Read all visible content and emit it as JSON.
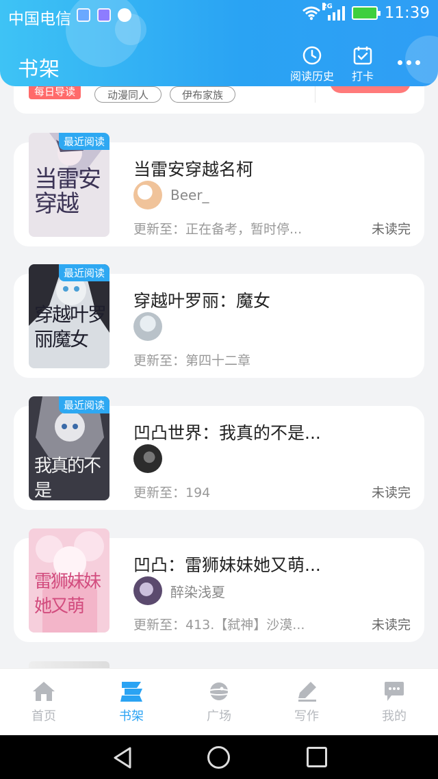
{
  "status_bar": {
    "carrier": "中国电信",
    "network": "2G",
    "time": "11:39"
  },
  "header": {
    "title": "书架",
    "history_label": "阅读历史",
    "checkin_label": "打卡"
  },
  "daily_card": {
    "label": "每日导读",
    "tags": [
      "动漫同人",
      "伊布家族"
    ]
  },
  "books": [
    {
      "title": "当雷安穿越名柯",
      "author": "Beer_",
      "update": "更新至：正在备考，暂时停...",
      "status": "未读完",
      "badge": "最近阅读",
      "cover_text": "当雷安穿越",
      "cover_bg": "#e9e4ea",
      "cover_ink": "#3b3355",
      "avatar_color": "#f0c39a"
    },
    {
      "title": "穿越叶罗丽：魔女",
      "author": "",
      "update": "更新至：第四十二章",
      "status": "",
      "badge": "最近阅读",
      "cover_text": "穿越叶罗丽魔女",
      "cover_bg": "#d9dde2",
      "cover_ink": "#1e1e2c",
      "avatar_color": "#b9c2c9"
    },
    {
      "title": "凹凸世界：我真的不是...",
      "author": "",
      "update": "更新至：194",
      "status": "未读完",
      "badge": "最近阅读",
      "cover_text": "我真的不是",
      "cover_bg": "#3a3a44",
      "cover_ink": "#f2f2f2",
      "avatar_color": "#2c2c2c"
    },
    {
      "title": "凹凸：雷狮妹妹她又萌...",
      "author": "醉染浅夏",
      "update": "更新至：413.【弑神】沙漠...",
      "status": "未读完",
      "badge": "",
      "cover_text": "雷狮妹妹她又萌",
      "cover_bg": "#f6cfdc",
      "cover_ink": "#d24c7e",
      "avatar_color": "#5b4a6e"
    }
  ],
  "tabs": [
    {
      "label": "首页",
      "icon": "home-icon"
    },
    {
      "label": "书架",
      "icon": "bookshelf-icon"
    },
    {
      "label": "广场",
      "icon": "planet-icon"
    },
    {
      "label": "写作",
      "icon": "pen-icon"
    },
    {
      "label": "我的",
      "icon": "chat-bubble-icon"
    }
  ],
  "active_tab": "书架",
  "colors": {
    "accent": "#2aa3f3",
    "badge": "#2ea8f2",
    "daily": "#ff6a6a"
  }
}
